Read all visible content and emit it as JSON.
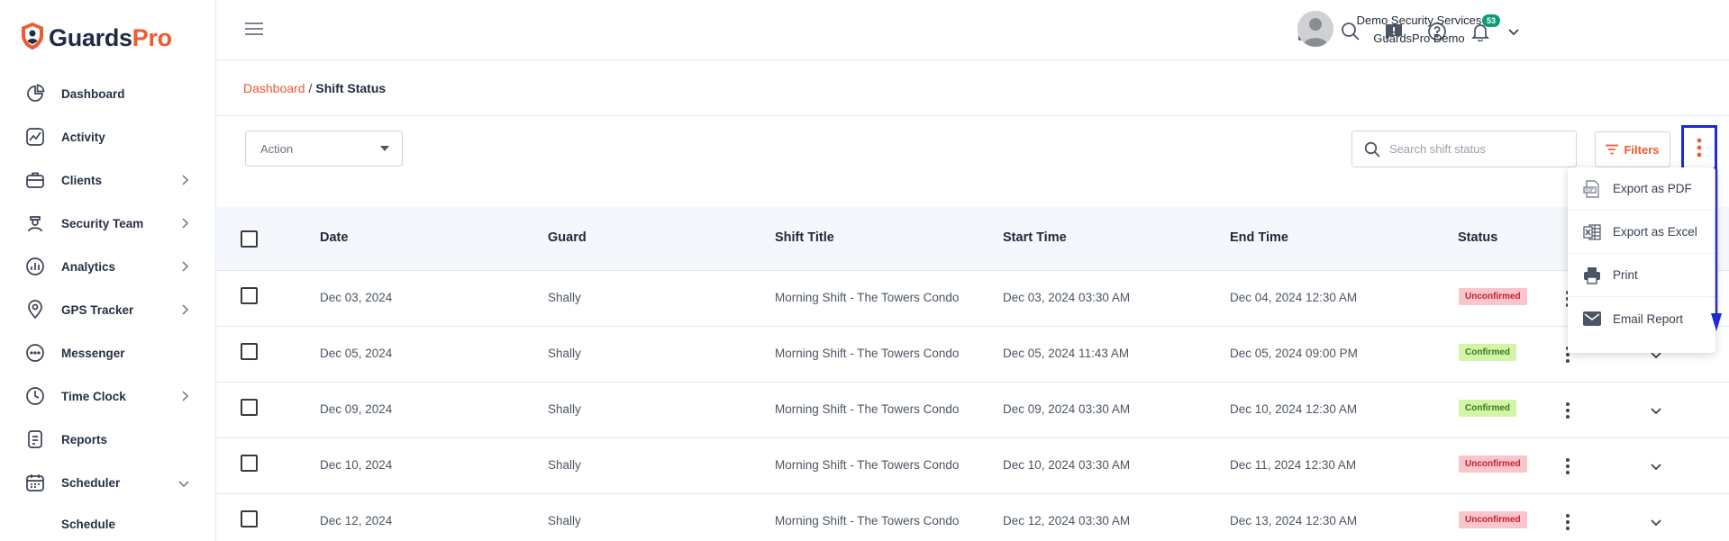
{
  "brand": {
    "name_part1": "Guards",
    "name_part2": "Pro",
    "accent_color": "#ef5a2e",
    "dark_color": "#1f2a44"
  },
  "sidebar": {
    "items": [
      {
        "label": "Dashboard",
        "icon": "dashboard-icon",
        "has_children": false
      },
      {
        "label": "Activity",
        "icon": "activity-icon",
        "has_children": false
      },
      {
        "label": "Clients",
        "icon": "briefcase-icon",
        "has_children": true
      },
      {
        "label": "Security Team",
        "icon": "guard-icon",
        "has_children": true
      },
      {
        "label": "Analytics",
        "icon": "analytics-icon",
        "has_children": true
      },
      {
        "label": "GPS Tracker",
        "icon": "map-pin-icon",
        "has_children": true
      },
      {
        "label": "Messenger",
        "icon": "chat-icon",
        "has_children": false
      },
      {
        "label": "Time Clock",
        "icon": "clock-icon",
        "has_children": true
      },
      {
        "label": "Reports",
        "icon": "reports-icon",
        "has_children": false
      },
      {
        "label": "Scheduler",
        "icon": "calendar-icon",
        "has_children": true,
        "expanded": true
      }
    ],
    "sub_items": [
      {
        "label": "Schedule"
      }
    ]
  },
  "header": {
    "notification_count": "53",
    "user_name": "Demo Security Services",
    "user_org": "GuardsPro Demo"
  },
  "breadcrumb": {
    "root": "Dashboard",
    "separator": "/",
    "current": "Shift Status"
  },
  "toolbar": {
    "action_placeholder": "Action",
    "search_placeholder": "Search shift status",
    "filters_label": "Filters"
  },
  "table": {
    "columns": [
      "Date",
      "Guard",
      "Shift Title",
      "Start Time",
      "End Time",
      "Status"
    ],
    "rows": [
      {
        "date": "Dec 03, 2024",
        "guard": "Shally",
        "title": "Morning Shift - The Towers Condo",
        "start": "Dec 03, 2024 03:30 AM",
        "end": "Dec 04, 2024 12:30 AM",
        "status": "Unconfirmed"
      },
      {
        "date": "Dec 05, 2024",
        "guard": "Shally",
        "title": "Morning Shift - The Towers Condo",
        "start": "Dec 05, 2024 11:43 AM",
        "end": "Dec 05, 2024 09:00 PM",
        "status": "Confirmed"
      },
      {
        "date": "Dec 09, 2024",
        "guard": "Shally",
        "title": "Morning Shift - The Towers Condo",
        "start": "Dec 09, 2024 03:30 AM",
        "end": "Dec 10, 2024 12:30 AM",
        "status": "Confirmed"
      },
      {
        "date": "Dec 10, 2024",
        "guard": "Shally",
        "title": "Morning Shift - The Towers Condo",
        "start": "Dec 10, 2024 03:30 AM",
        "end": "Dec 11, 2024 12:30 AM",
        "status": "Unconfirmed"
      },
      {
        "date": "Dec 12, 2024",
        "guard": "Shally",
        "title": "Morning Shift - The Towers Condo",
        "start": "Dec 12, 2024 03:30 AM",
        "end": "Dec 13, 2024 12:30 AM",
        "status": "Unconfirmed"
      }
    ]
  },
  "export_menu": {
    "items": [
      {
        "label": "Export as PDF",
        "icon": "pdf-icon"
      },
      {
        "label": "Export as Excel",
        "icon": "excel-icon"
      },
      {
        "label": "Print",
        "icon": "printer-icon"
      },
      {
        "label": "Email Report",
        "icon": "email-icon"
      }
    ]
  },
  "colors": {
    "highlight_box": "#1d2ad6",
    "unconfirmed_bg": "#f8c6cb",
    "confirmed_bg": "#d3f5a8",
    "badge_green": "#0f9b78"
  }
}
